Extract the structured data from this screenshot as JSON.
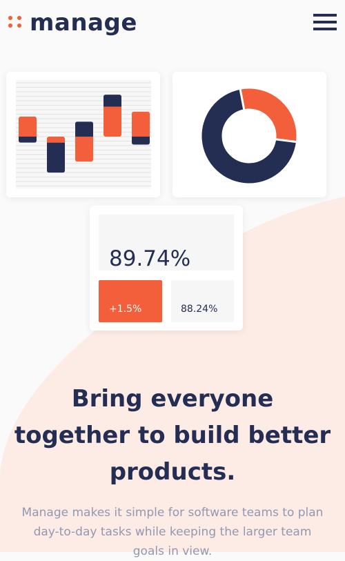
{
  "brand": {
    "name": "manage",
    "accent": "#f25f3a",
    "dark": "#242d52",
    "blob": "#fdebe6"
  },
  "header": {
    "logo_icon": "four-dots-logo-icon",
    "menu_icon": "hamburger-menu-icon"
  },
  "chart_data": [
    {
      "type": "bar",
      "categories": [
        "",
        "",
        "",
        "",
        ""
      ],
      "series": [
        {
          "values": [
            2,
            -0.6,
            -2.5,
            3,
            2.5
          ]
        },
        {
          "values": [
            -0.6,
            -3,
            1.5,
            1.2,
            -0.8
          ]
        }
      ],
      "grid": true
    },
    {
      "type": "pie",
      "values": [
        30,
        70
      ],
      "colors": [
        "#f25f3a",
        "#242d52"
      ],
      "donut": true
    }
  ],
  "stats": {
    "main_value": "89.74%",
    "change_value": "+1.5%",
    "secondary_value": "88.24%"
  },
  "hero": {
    "headline": "Bring everyone together to build better products.",
    "subtext": "Manage makes it simple for software teams to plan day-to-day tasks while keeping the larger team goals in view."
  }
}
